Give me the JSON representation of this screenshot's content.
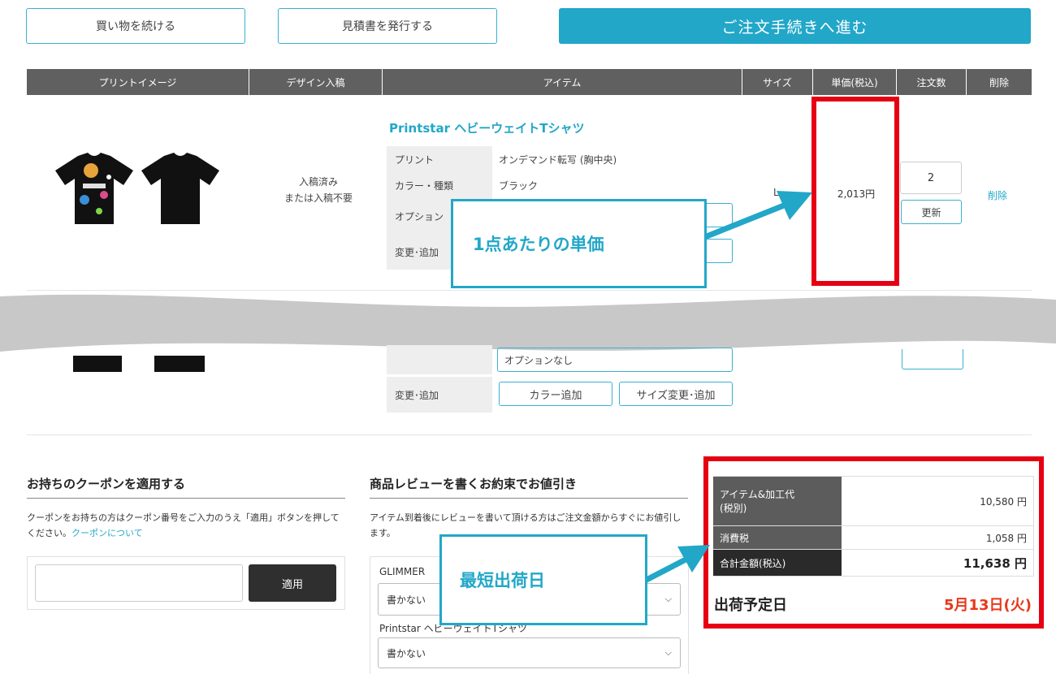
{
  "top_buttons": {
    "continue": "買い物を続ける",
    "quote": "見積書を発行する",
    "checkout": "ご注文手続きへ進む"
  },
  "table_headers": {
    "print_image": "プリントイメージ",
    "design": "デザイン入稿",
    "item": "アイテム",
    "size": "サイズ",
    "unit_price": "単価(税込)",
    "qty": "注文数",
    "delete": "削除"
  },
  "row1": {
    "design_status_1": "入稿済み",
    "design_status_2": "または入稿不要",
    "product_name": "Printstar ヘビーウェイトTシャツ",
    "print_label": "プリント",
    "print_value": "オンデマンド転写 (胸中央)",
    "color_label": "カラー・種類",
    "color_value": "ブラック",
    "option_label": "オプション",
    "change_label": "変更･追加",
    "size_value": "L",
    "unit_price": "2,013円",
    "qty": "2",
    "update_label": "更新",
    "delete_label": "削除"
  },
  "row2": {
    "option_value": "オプションなし",
    "change_label": "変更･追加",
    "color_add": "カラー追加",
    "size_change": "サイズ変更･追加"
  },
  "callouts": {
    "unit_price": "1点あたりの単価",
    "ship_date": "最短出荷日"
  },
  "coupon": {
    "title": "お持ちのクーポンを適用する",
    "desc": "クーポンをお持ちの方はクーポン番号をご入力のうえ「適用」ボタンを押してください。",
    "link": "クーポンについて",
    "input_placeholder": "",
    "apply": "適用"
  },
  "review": {
    "title": "商品レビューを書くお約束でお値引き",
    "desc": "アイテム到着後にレビューを書いて頂ける方はご注文金額からすぐにお値引します。",
    "item1": "GLIMMER",
    "select1": "書かない",
    "item2": "Printstar ヘビーウェイトTシャツ",
    "select2": "書かない"
  },
  "summary": {
    "items_label_1": "アイテム&加工代",
    "items_label_2": "(税別)",
    "items_value": "10,580 円",
    "tax_label": "消費税",
    "tax_value": "1,058 円",
    "total_label": "合計金額(税込)",
    "total_value": "11,638 円",
    "ship_label": "出荷予定日",
    "ship_value": "5月13日(火)"
  },
  "colors": {
    "accent": "#22a7c8",
    "highlight_red": "#e60012",
    "header_gray": "#606060",
    "ship_date_red": "#e8381a"
  }
}
